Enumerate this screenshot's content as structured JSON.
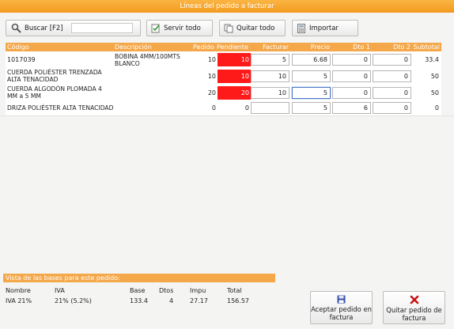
{
  "window": {
    "title": "Líneas del pedido a facturar"
  },
  "toolbar": {
    "search_label": "Buscar [F2]",
    "search_value": "",
    "servir_label": "Servir todo",
    "quitar_label": "Quitar todo",
    "importar_label": "Importar"
  },
  "table": {
    "headers": {
      "codigo": "Código",
      "descripcion": "Descripción",
      "pedido": "Pedido",
      "pendiente": "Pendiente",
      "facturar": "Facturar",
      "precio": "Precio",
      "dto1": "Dto 1",
      "dto2": "Dto 2",
      "subtotal": "Subtotal"
    },
    "rows": [
      {
        "codigo": "1017039",
        "descripcion": "BOBINA 4MM/100MTS BLANCO",
        "pedido": "10",
        "pendiente": "10",
        "facturar": "5",
        "precio": "6.68",
        "dto1": "0",
        "dto2": "0",
        "subtotal": "33.4"
      },
      {
        "codigo": "",
        "descripcion": "CUERDA POLIÉSTER TRENZADA ALTA TENACIDAD",
        "pedido": "10",
        "pendiente": "10",
        "facturar": "10",
        "precio": "5",
        "dto1": "0",
        "dto2": "0",
        "subtotal": "50"
      },
      {
        "codigo": "",
        "descripcion": "CUERDA ALGODÓN PLOMADA 4 MM a 5 MM",
        "pedido": "20",
        "pendiente": "20",
        "facturar": "10",
        "precio": "5",
        "dto1": "0",
        "dto2": "0",
        "subtotal": "50"
      },
      {
        "codigo": "",
        "descripcion": "DRIZA POLIÉSTER ALTA TENACIDAD",
        "pedido": "0",
        "pendiente": "0",
        "facturar": "",
        "precio": "5",
        "dto1": "6",
        "dto2": "0",
        "subtotal": "0"
      }
    ]
  },
  "bases": {
    "title": "Vista de las bases para este pedido:",
    "headers": {
      "nombre": "Nombre",
      "iva": "IVA",
      "base": "Base",
      "dtos": "Dtos",
      "impu": "Impu",
      "total": "Total"
    },
    "row": {
      "nombre": "IVA 21%",
      "iva": "21% (5.2%)",
      "base": "133.4",
      "dtos": "4",
      "impu": "27.17",
      "total": "156.57"
    }
  },
  "actions": {
    "aceptar_label": "Aceptar pedido en factura",
    "quitar_label": "Quitar pedido de factura"
  },
  "colors": {
    "accent": "#f4a84a",
    "pending": "#ff1a1a"
  }
}
